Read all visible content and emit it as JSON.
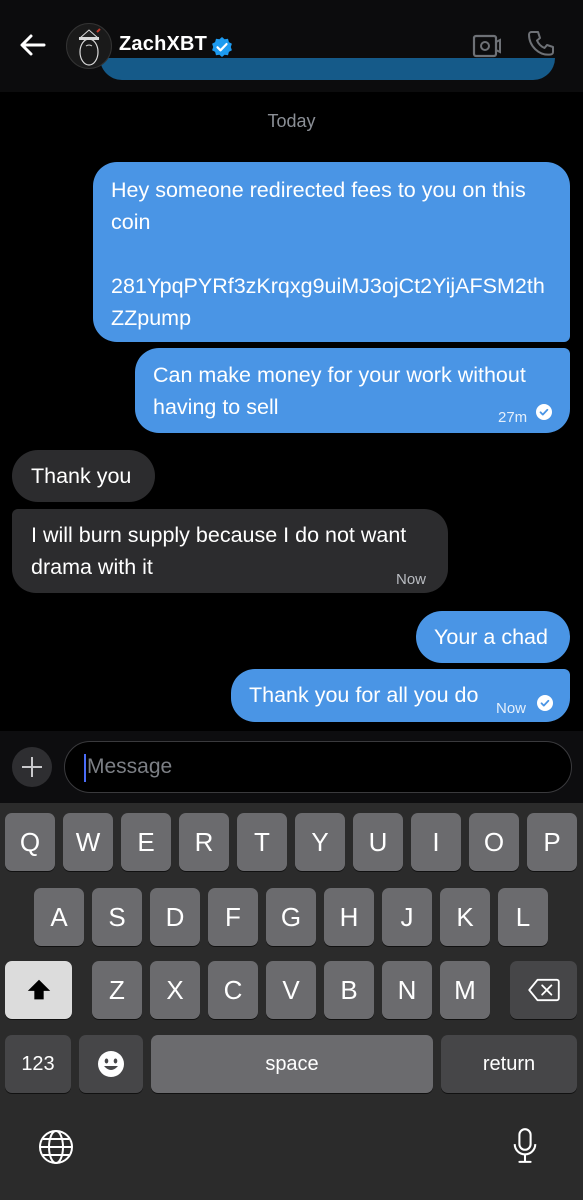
{
  "header": {
    "contact_name": "ZachXBT"
  },
  "date_separator": "Today",
  "messages": [
    {
      "direction": "outgoing",
      "text": "Hey someone redirected fees to you on this\ncoin\n\n281YpqPYRf3zKrqxg9uiMJ3ojCt2YijAFSM2thZZpump",
      "time": ""
    },
    {
      "direction": "outgoing",
      "text": "Can make money for your work without\nhaving to sell",
      "time": "27m"
    },
    {
      "direction": "incoming",
      "text": "Thank you",
      "time": ""
    },
    {
      "direction": "incoming",
      "text": "I will burn supply because I do not want\ndrama with it",
      "time": "Now"
    },
    {
      "direction": "outgoing",
      "text": "Your a chad",
      "time": ""
    },
    {
      "direction": "outgoing",
      "text": "Thank you for all you do",
      "time": "Now"
    }
  ],
  "composer": {
    "placeholder": "Message"
  },
  "keyboard": {
    "row1": [
      "Q",
      "W",
      "E",
      "R",
      "T",
      "Y",
      "U",
      "I",
      "O",
      "P"
    ],
    "row2": [
      "A",
      "S",
      "D",
      "F",
      "G",
      "H",
      "J",
      "K",
      "L"
    ],
    "row3": [
      "Z",
      "X",
      "C",
      "V",
      "B",
      "N",
      "M"
    ],
    "numbers_label": "123",
    "space_label": "space",
    "return_label": "return"
  },
  "colors": {
    "outgoing_bubble": "#4a95e5",
    "incoming_bubble": "#2c2c2e",
    "verified_badge": "#1d9bf0"
  },
  "icons": [
    "back-arrow-icon",
    "verified-icon",
    "video-call-icon",
    "phone-icon",
    "check-icon",
    "plus-icon",
    "shift-icon",
    "backspace-icon",
    "emoji-icon",
    "globe-icon",
    "microphone-icon"
  ]
}
